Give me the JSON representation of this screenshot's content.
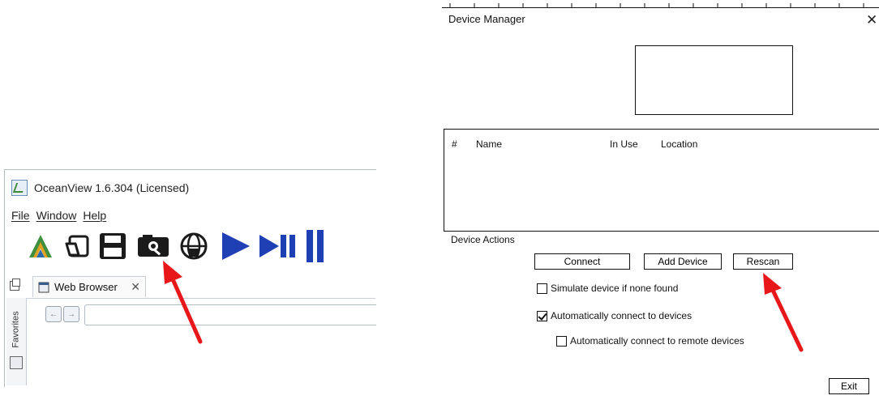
{
  "left_panel": {
    "title": "OceanView 1.6.304 (Licensed)",
    "menu": [
      {
        "label": "File"
      },
      {
        "label": "Window"
      },
      {
        "label": "Help"
      }
    ],
    "toolbar": {
      "icons": [
        "spectrasuite-logo-icon",
        "open-project-icon",
        "save-icon",
        "device-manager-icon",
        "network-icon",
        "play-icon",
        "single-acquire-icon",
        "pause-icon"
      ],
      "highlighted_icon": "device-manager-icon"
    },
    "tab": {
      "label": "Web Browser",
      "close_glyph": "✕"
    },
    "side_tab": "Favorites",
    "nav": {
      "back": "←",
      "forward": "→"
    }
  },
  "right_panel": {
    "title": "Device Manager",
    "close_glyph": "✕",
    "table_headers": [
      "#",
      "Name",
      "In Use",
      "Location"
    ],
    "actions_label": "Device Actions",
    "buttons": {
      "connect": "Connect",
      "add_device": "Add Device",
      "rescan": "Rescan",
      "exit": "Exit"
    },
    "checkboxes": [
      {
        "label": "Simulate device if none found",
        "checked": false
      },
      {
        "label": "Automatically connect to devices",
        "checked": true
      },
      {
        "label": "Automatically connect to remote devices",
        "checked": false
      }
    ]
  },
  "annotations": {
    "arrow_color": "#e8171a"
  },
  "colors": {
    "play_blue": "#1f3fb5",
    "toolbar_dark": "#1b1b1b"
  }
}
